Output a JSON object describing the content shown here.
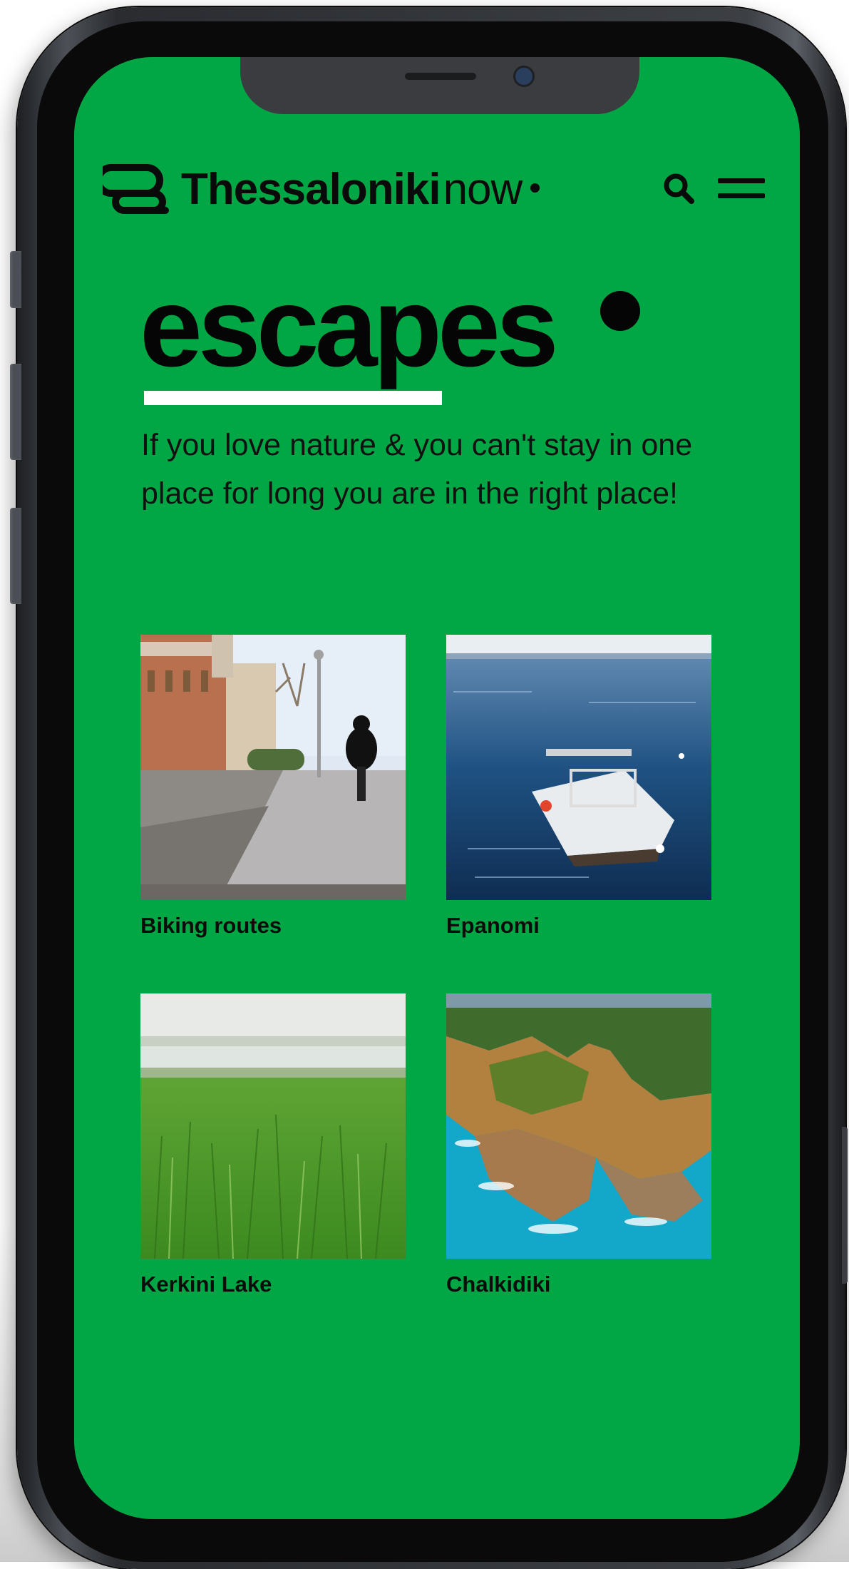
{
  "header": {
    "brand_name": "Thessaloniki",
    "brand_suffix": "now",
    "search_icon": "search-icon",
    "menu_icon": "hamburger-menu-icon"
  },
  "hero": {
    "title": "escapes",
    "description": "If you love nature & you can't stay in one place for long you are in the right place!"
  },
  "escapes": [
    {
      "label": "Biking routes",
      "image": "cyclist on waterfront promenade"
    },
    {
      "label": "Epanomi",
      "image": "small motorboat on sea"
    },
    {
      "label": "Kerkini Lake",
      "image": "green grass field with lake"
    },
    {
      "label": "Chalkidiki",
      "image": "aerial rocky coastline turquoise sea"
    }
  ],
  "colors": {
    "screen_background": "#02a745",
    "text": "#0a0a0a",
    "underline": "#ffffff"
  }
}
